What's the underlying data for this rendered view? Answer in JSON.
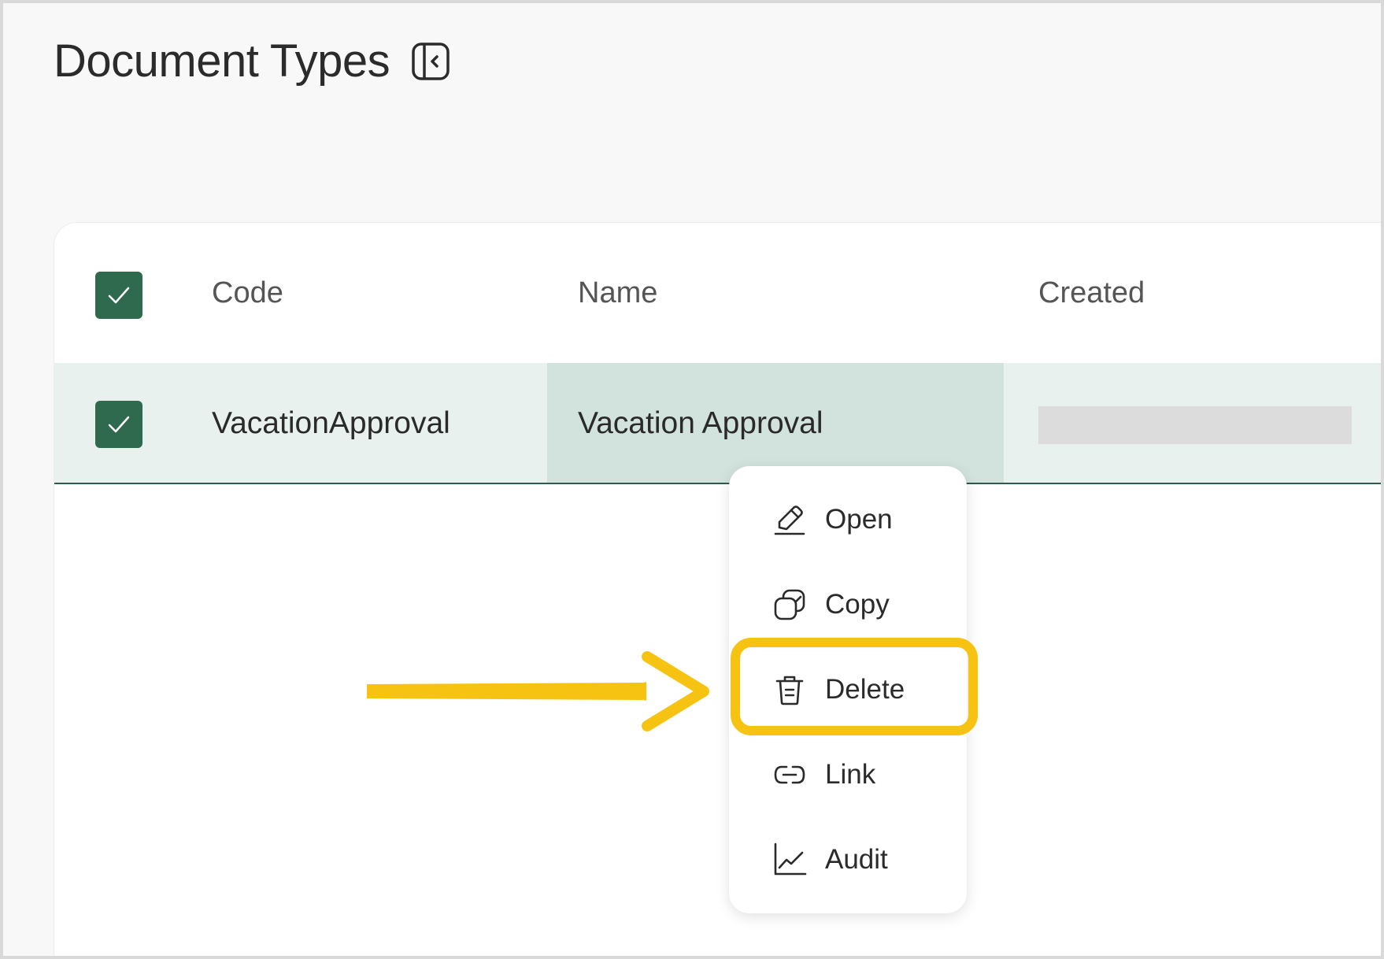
{
  "page": {
    "title": "Document Types",
    "sidebar_toggle_icon": "sidebar-collapse-icon"
  },
  "table": {
    "columns": [
      "Code",
      "Name",
      "Created"
    ],
    "rows": [
      {
        "code": "VacationApproval",
        "name": "Vacation Approval",
        "created": "",
        "selected": true
      }
    ],
    "select_all_checked": true
  },
  "context_menu": {
    "items": [
      {
        "label": "Open",
        "icon": "pencil-icon"
      },
      {
        "label": "Copy",
        "icon": "copy-icon"
      },
      {
        "label": "Delete",
        "icon": "trash-icon",
        "highlighted": true
      },
      {
        "label": "Link",
        "icon": "link-icon"
      },
      {
        "label": "Audit",
        "icon": "chart-line-icon"
      }
    ]
  },
  "colors": {
    "accent": "#2f6a4f",
    "row_selected": "#e8f1ee",
    "cell_focused": "#d2e3dd",
    "highlight": "#f7c313"
  }
}
